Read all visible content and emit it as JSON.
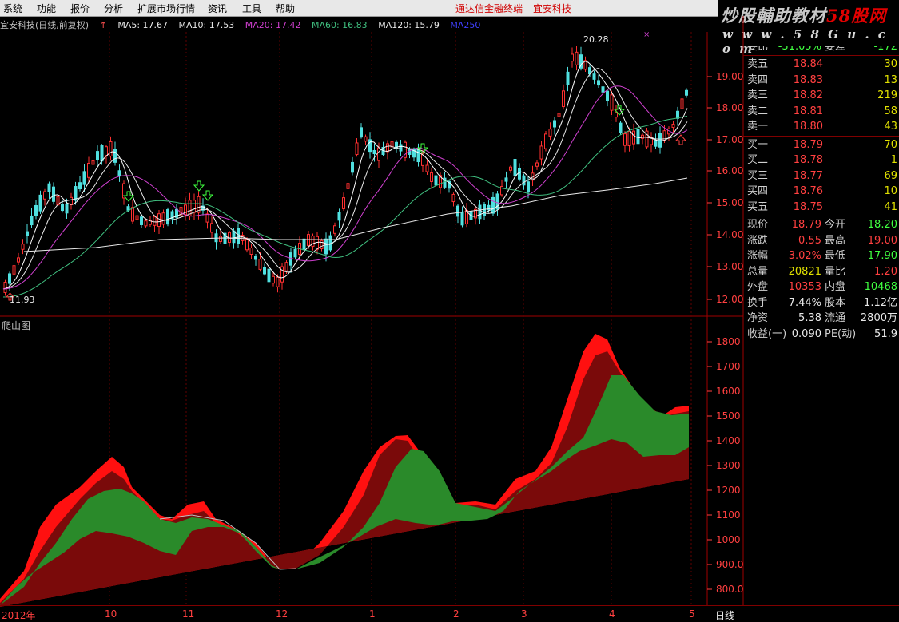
{
  "menu": {
    "items": [
      "系统",
      "功能",
      "报价",
      "分析",
      "扩展市场行情",
      "资讯",
      "工具",
      "帮助"
    ],
    "center_left": "通达信金融终端",
    "center_right": "宜安科技"
  },
  "logo": {
    "line1_a": "炒股輔助教材",
    "line1_b": "58股网",
    "line2": "w w w . 5 8 G u . c o m"
  },
  "ma_bar": {
    "title": "宜安科技(日线,前复权)",
    "items": [
      {
        "label": "MA5: 17.67",
        "color": "#e8e8e8"
      },
      {
        "label": "MA10: 17.53",
        "color": "#e8e8e8"
      },
      {
        "label": "MA20: 17.42",
        "color": "#d040d0"
      },
      {
        "label": "MA60: 16.83",
        "color": "#40c080"
      },
      {
        "label": "MA120: 15.79",
        "color": "#e8e8e8"
      },
      {
        "label": "MA250",
        "color": "#4040ff"
      }
    ]
  },
  "main_chart": {
    "price_ticks": [
      "19.00",
      "18.00",
      "17.00",
      "16.00",
      "15.00",
      "14.00",
      "13.00",
      "12.00"
    ],
    "high_label": "20.28",
    "low_label": "11.93"
  },
  "indicator": {
    "label": "爬山图",
    "ticks": [
      "1800",
      "1700",
      "1600",
      "1500",
      "1400",
      "1300",
      "1200",
      "1100",
      "1000",
      "900.0",
      "800.0"
    ]
  },
  "x_axis": {
    "labels": [
      "2012年",
      "10",
      "11",
      "12",
      "1",
      "2",
      "3",
      "4",
      "5"
    ],
    "mode": "日线"
  },
  "order_book": {
    "top_partial": {
      "label": "委比",
      "value": "-31.05%",
      "label2": "委差",
      "value2": "-172"
    },
    "sells": [
      {
        "label": "卖五",
        "price": "18.84",
        "vol": "30"
      },
      {
        "label": "卖四",
        "price": "18.83",
        "vol": "13"
      },
      {
        "label": "卖三",
        "price": "18.82",
        "vol": "219"
      },
      {
        "label": "卖二",
        "price": "18.81",
        "vol": "58"
      },
      {
        "label": "卖一",
        "price": "18.80",
        "vol": "43"
      }
    ],
    "buys": [
      {
        "label": "买一",
        "price": "18.79",
        "vol": "70"
      },
      {
        "label": "买二",
        "price": "18.78",
        "vol": "1"
      },
      {
        "label": "买三",
        "price": "18.77",
        "vol": "69"
      },
      {
        "label": "买四",
        "price": "18.76",
        "vol": "10"
      },
      {
        "label": "买五",
        "price": "18.75",
        "vol": "41"
      }
    ]
  },
  "quote": [
    {
      "l1": "现价",
      "v1": "18.79",
      "c1": "red",
      "l2": "今开",
      "v2": "18.20",
      "c2": "green"
    },
    {
      "l1": "涨跌",
      "v1": "0.55",
      "c1": "red",
      "l2": "最高",
      "v2": "19.00",
      "c2": "red"
    },
    {
      "l1": "涨幅",
      "v1": "3.02%",
      "c1": "red",
      "l2": "最低",
      "v2": "17.90",
      "c2": "green"
    },
    {
      "l1": "总量",
      "v1": "20821",
      "c1": "yellow",
      "l2": "量比",
      "v2": "1.20",
      "c2": "red"
    },
    {
      "l1": "外盘",
      "v1": "10353",
      "c1": "red",
      "l2": "内盘",
      "v2": "10468",
      "c2": "green"
    },
    {
      "l1": "换手",
      "v1": "7.44%",
      "c1": "white",
      "l2": "股本",
      "v2": "1.12亿",
      "c2": "white"
    },
    {
      "l1": "净资",
      "v1": "5.38",
      "c1": "white",
      "l2": "流通",
      "v2": "2800万",
      "c2": "white"
    },
    {
      "l1": "收益(一)",
      "v1": "0.090",
      "c1": "white",
      "l2": "PE(动)",
      "v2": "51.9",
      "c2": "white"
    }
  ]
}
